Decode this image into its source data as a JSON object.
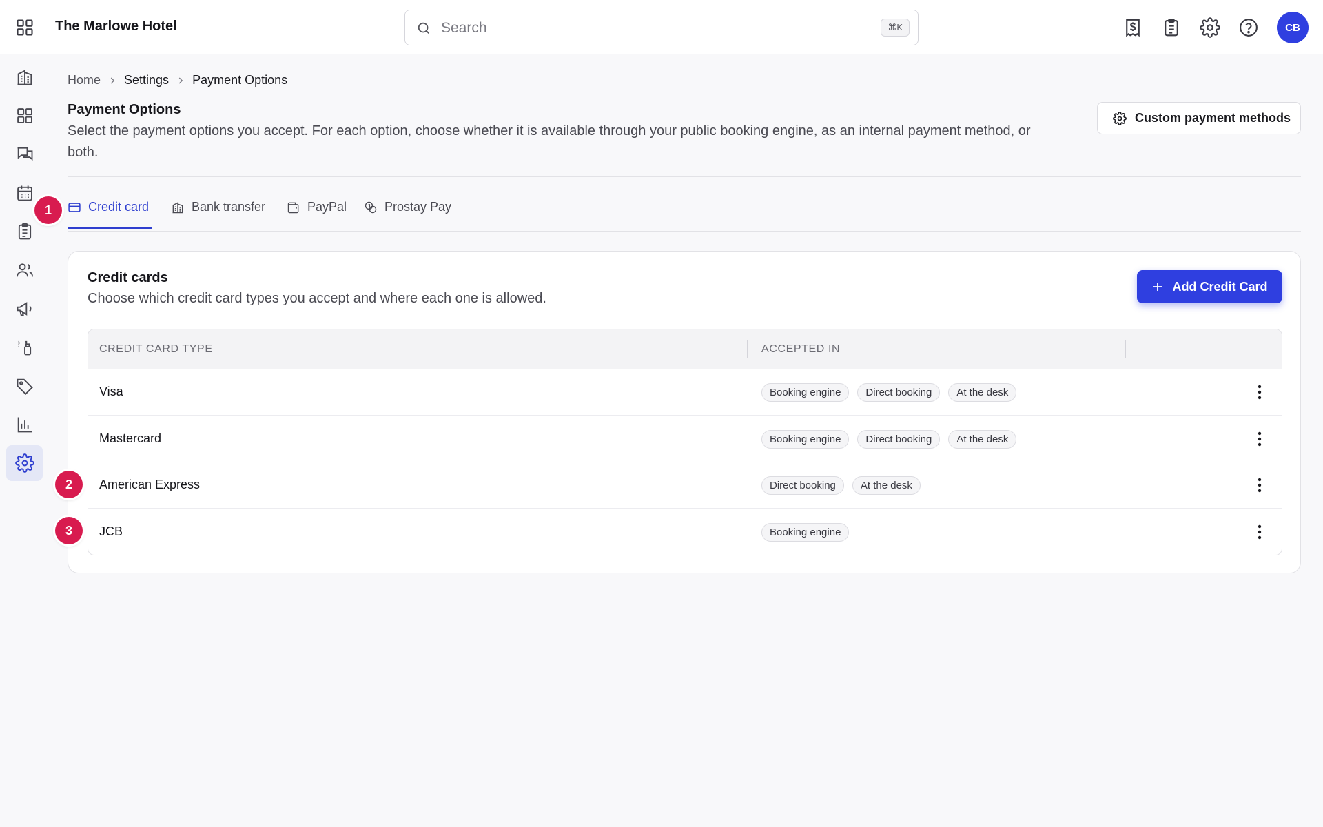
{
  "app": {
    "hotel_name": "The Marlowe Hotel",
    "avatar_initials": "CB",
    "accent_color": "#2f3fe0",
    "badge_color": "#d81b4f"
  },
  "search": {
    "placeholder": "Search",
    "shortcut": "⌘K"
  },
  "topbar_icons": [
    "invoice-dollar-icon",
    "clipboard-icon",
    "gear-icon",
    "help-icon"
  ],
  "sidebar": {
    "items": [
      {
        "icon": "building-icon"
      },
      {
        "icon": "dashboard-icon"
      },
      {
        "icon": "messages-icon"
      },
      {
        "icon": "calendar-icon"
      },
      {
        "icon": "clipboard-icon"
      },
      {
        "icon": "guests-icon"
      },
      {
        "icon": "megaphone-icon"
      },
      {
        "icon": "cleaning-spray-icon"
      },
      {
        "icon": "tag-icon"
      },
      {
        "icon": "bar-chart-icon"
      },
      {
        "icon": "gear-icon",
        "active": true
      }
    ]
  },
  "breadcrumb": {
    "home": "Home",
    "settings": "Settings",
    "current": "Payment Options"
  },
  "page": {
    "title": "Payment Options",
    "description": "Select the payment options you accept. For each option, choose whether it is available through your public booking engine, as an internal payment method, or both.",
    "custom_button": "Custom payment methods"
  },
  "tabs": [
    {
      "label": "Credit card",
      "icon": "credit-card-icon",
      "active": true
    },
    {
      "label": "Bank transfer",
      "icon": "bank-icon"
    },
    {
      "label": "PayPal",
      "icon": "wallet-icon"
    },
    {
      "label": "Prostay Pay",
      "icon": "coins-icon"
    }
  ],
  "badges": [
    "1",
    "2",
    "3"
  ],
  "card": {
    "title": "Credit cards",
    "description": "Choose which credit card types you accept and where each one is allowed.",
    "add_button": "Add Credit Card"
  },
  "table": {
    "columns": [
      "CREDIT CARD TYPE",
      "ACCEPTED IN"
    ],
    "rows": [
      {
        "name": "Visa",
        "accepted": [
          "Booking engine",
          "Direct booking",
          "At the desk"
        ]
      },
      {
        "name": "Mastercard",
        "accepted": [
          "Booking engine",
          "Direct booking",
          "At the desk"
        ]
      },
      {
        "name": "American Express",
        "accepted": [
          "Direct booking",
          "At the desk"
        ]
      },
      {
        "name": "JCB",
        "accepted": [
          "Booking engine"
        ]
      }
    ]
  }
}
